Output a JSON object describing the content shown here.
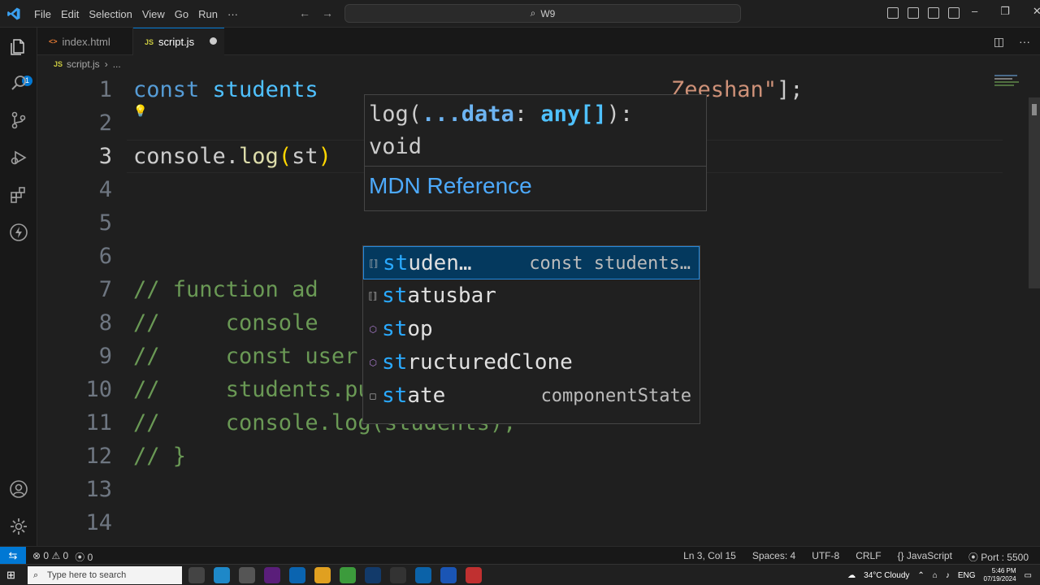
{
  "titlebar": {
    "menu": [
      "File",
      "Edit",
      "Selection",
      "View",
      "Go",
      "Run",
      "···"
    ],
    "search": "W9"
  },
  "tabs": [
    {
      "label": "index.html",
      "icon": "html-file-icon",
      "active": false
    },
    {
      "label": "script.js",
      "icon": "js-file-icon",
      "active": true,
      "dirty": true
    }
  ],
  "file_badge": "JS",
  "breadcrumb": {
    "file": "script.js",
    "rest": "..."
  },
  "activity_badge": "1",
  "code_lines": [
    {
      "num": "1",
      "parts": [
        [
          "kw",
          "const"
        ],
        [
          "plain",
          " "
        ],
        [
          "var",
          "students"
        ]
      ],
      "tail": [
        [
          "str",
          "Zeeshan\""
        ],
        [
          "plain",
          "];"
        ]
      ]
    },
    {
      "num": "2",
      "parts": []
    },
    {
      "num": "3",
      "parts": [
        [
          "plain",
          "console."
        ],
        [
          "fn",
          "log"
        ],
        [
          "brace",
          "("
        ],
        [
          "plain",
          "st"
        ],
        [
          "brace",
          ")"
        ]
      ]
    },
    {
      "num": "4",
      "parts": []
    },
    {
      "num": "5",
      "parts": []
    },
    {
      "num": "6",
      "parts": []
    },
    {
      "num": "7",
      "parts": [
        [
          "cmt",
          "// function ad"
        ]
      ]
    },
    {
      "num": "8",
      "parts": [
        [
          "cmt",
          "//     console"
        ]
      ]
    },
    {
      "num": "9",
      "parts": [
        [
          "cmt",
          "//     const user = prompt(\"Enter Name\");"
        ]
      ]
    },
    {
      "num": "10",
      "parts": [
        [
          "cmt",
          "//     students.push(user);"
        ]
      ]
    },
    {
      "num": "11",
      "parts": [
        [
          "cmt",
          "//     console.log(students);"
        ]
      ]
    },
    {
      "num": "12",
      "parts": [
        [
          "cmt",
          "// }"
        ]
      ]
    },
    {
      "num": "13",
      "parts": []
    },
    {
      "num": "14",
      "parts": []
    }
  ],
  "hover": {
    "signature_line1": "log(...data: any[]):",
    "signature_line2": "void",
    "link": "MDN Reference"
  },
  "suggestions": [
    {
      "match": "st",
      "rest": "uden…",
      "detail": "const students…",
      "icon": "variable-icon",
      "selected": true
    },
    {
      "match": "st",
      "rest": "atusbar",
      "detail": "",
      "icon": "variable-icon",
      "selected": false
    },
    {
      "match": "st",
      "rest": "op",
      "detail": "",
      "icon": "method-icon",
      "selected": false
    },
    {
      "match": "st",
      "rest": "ructuredClone",
      "detail": "",
      "icon": "method-icon",
      "selected": false
    },
    {
      "match": "st",
      "rest": "ate",
      "detail": "componentState",
      "icon": "field-icon",
      "selected": false
    }
  ],
  "status": {
    "errors": "0",
    "warnings": "0",
    "ports_open": "0",
    "position": "Ln 3, Col 15",
    "spaces": "Spaces: 4",
    "encoding": "UTF-8",
    "eol": "CRLF",
    "language": "JavaScript",
    "port": "Port : 5500"
  },
  "taskbar": {
    "search_placeholder": "Type here to search",
    "weather": "34°C  Cloudy",
    "lang": "ENG",
    "time": "5:46 PM",
    "date": "07/19/2024"
  },
  "colors": {
    "accent": "#0078d4",
    "keyword": "#569cd6",
    "string": "#ce9178",
    "comment": "#6a9955",
    "function": "#dcdcaa",
    "match": "#2aaaff"
  }
}
